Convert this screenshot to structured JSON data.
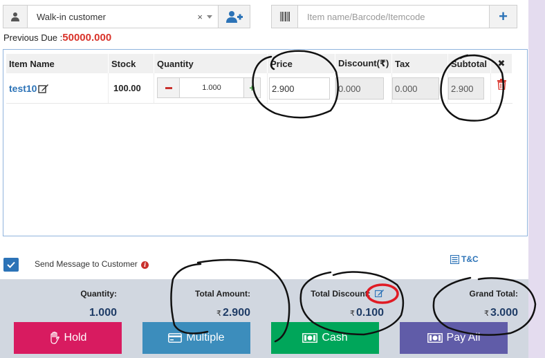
{
  "customer": {
    "selected": "Walk-in customer",
    "clear_symbol": "×"
  },
  "item_search": {
    "placeholder": "Item name/Barcode/Itemcode"
  },
  "previous_due": {
    "label": "Previous Due :",
    "amount": "50000.000"
  },
  "table": {
    "headers": {
      "item_name": "Item Name",
      "stock": "Stock",
      "quantity": "Quantity",
      "price": "Price",
      "discount": "Discount(₹)",
      "tax": "Tax",
      "subtotal": "Subtotal",
      "remove": "✖"
    },
    "rows": [
      {
        "item_name": "test10",
        "stock": "100.00",
        "quantity": "1.000",
        "price": "2.900",
        "discount": "0.000",
        "tax": "0.000",
        "subtotal": "2.900"
      }
    ]
  },
  "send_message": {
    "label": "Send Message to Customer",
    "checked": true
  },
  "tnc": {
    "label": "T&C"
  },
  "summary": {
    "currency": "₹",
    "quantity_label": "Quantity:",
    "quantity_value": "1.000",
    "total_amount_label": "Total Amount:",
    "total_amount_value": "2.900",
    "total_discount_label": "Total Discount:",
    "total_discount_value": "0.100",
    "grand_total_label": "Grand Total:",
    "grand_total_value": "3.000"
  },
  "buttons": {
    "hold": "Hold",
    "multiple": "Multiple",
    "cash": "Cash",
    "pay_all": "Pay All"
  },
  "colors": {
    "accent": "#2c73b7",
    "danger": "#d9332a",
    "hold": "#d81b60",
    "multiple": "#3c8dbc",
    "cash": "#00a65a",
    "pay_all": "#605ca8"
  }
}
